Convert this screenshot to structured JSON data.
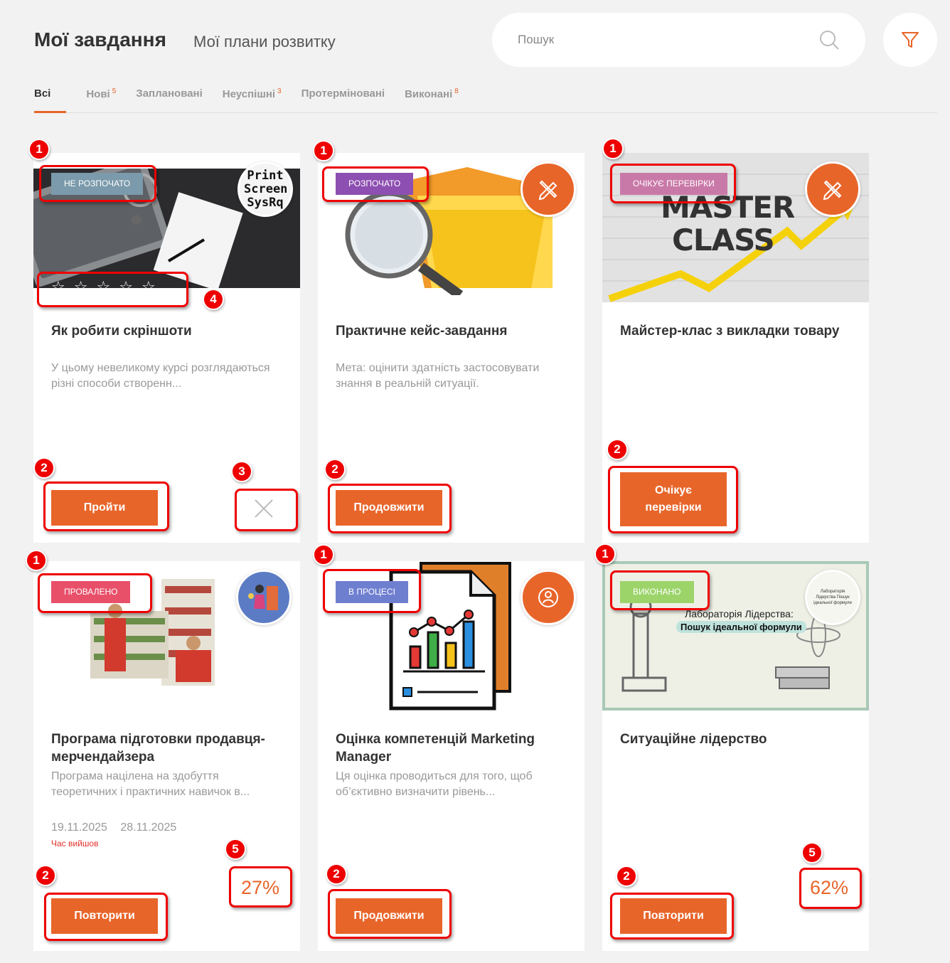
{
  "header": {
    "title": "Мої завдання",
    "subtitle": "Мої плани розвитку",
    "search_placeholder": "Пошук"
  },
  "tabs": [
    {
      "label": "Всі",
      "count": ""
    },
    {
      "label": "Нові",
      "count": "5"
    },
    {
      "label": "Заплановані",
      "count": ""
    },
    {
      "label": "Неуспішні",
      "count": "3"
    },
    {
      "label": "Протерміновані",
      "count": ""
    },
    {
      "label": "Виконані",
      "count": "8"
    }
  ],
  "cards": [
    {
      "badge": "НЕ РОЗПОЧАТО",
      "badge_color": "#7b9aab",
      "title": "Як робити скріншоти",
      "description": "У цьому невеликому курсі розглядаються різні способи створенн...",
      "button": "Пройти",
      "corner_text": "Print Screen SysRq",
      "rating": 0
    },
    {
      "badge": "РОЗПОЧАТО",
      "badge_color": "#8d4fb1",
      "title": "Практичне кейс-завдання",
      "description": "Мета: оцінити здатність застосовувати знання в реальній ситуації.",
      "button": "Продовжити",
      "corner_icon": "pencil-ruler-icon"
    },
    {
      "badge": "ОЧІКУЄ ПЕРЕВІРКИ",
      "badge_color": "#c979a8",
      "title": "Майстер-клас з викладки товару",
      "description": "",
      "button": "Очікує перевірки",
      "image_text": [
        "MASTER",
        "CLASS"
      ],
      "corner_icon": "pencil-ruler-icon"
    },
    {
      "badge": "ПРОВАЛЕНО",
      "badge_color": "#e8506a",
      "title": "Програма підготовки продавця-мерчендайзера",
      "description": "Програма націлена на здобуття теоретичних і практичних навичок в...",
      "date_start": "19.11.2025",
      "date_end": "28.11.2025",
      "expired": "Час вийшов",
      "progress": "27%",
      "button": "Повторити"
    },
    {
      "badge": "В ПРОЦЕСІ",
      "badge_color": "#6f7fd0",
      "title": "Оцінка компетенцій Marketing Manager",
      "description": "Ця оцінка проводиться для того, щоб об’єктивно визначити рівень...",
      "button": "Продовжити",
      "corner_icon": "people-circle-icon"
    },
    {
      "badge": "ВИКОНАНО",
      "badge_color": "#9cd46a",
      "title": "Ситуаційне лідерство",
      "description": "",
      "progress": "62%",
      "button": "Повторити",
      "image_text": [
        "Лабораторія Лідерства:",
        "Пошук ідеальної формули"
      ],
      "corner_text": "Лабораторія Лідерства Пошук ідеальної формули"
    }
  ],
  "annotations": [
    "1",
    "2",
    "3",
    "4",
    "5"
  ],
  "colors": {
    "accent": "#e8652a",
    "annotation": "#e00000"
  }
}
